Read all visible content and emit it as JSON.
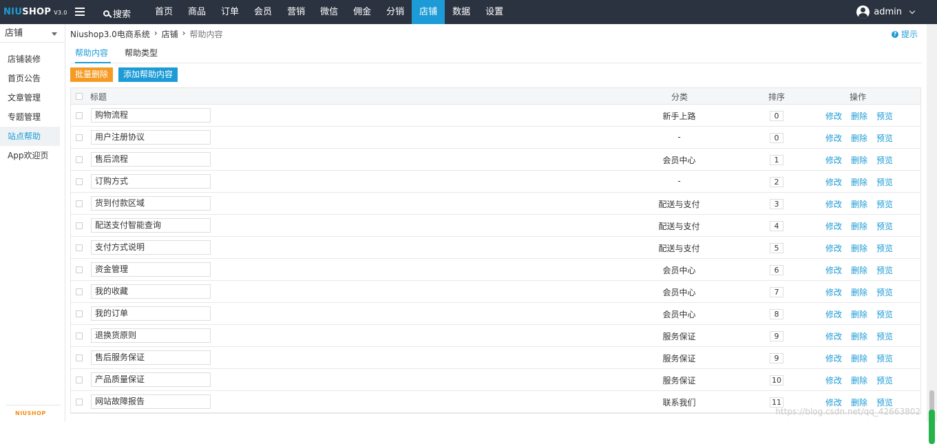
{
  "header": {
    "logo": {
      "niu": "NIU",
      "shop": "SHOP",
      "version": "V3.0"
    },
    "search_label": "搜索",
    "nav": [
      "首页",
      "商品",
      "订单",
      "会员",
      "营销",
      "微信",
      "佣金",
      "分销",
      "店铺",
      "数据",
      "设置"
    ],
    "nav_active": "店铺",
    "user": "admin"
  },
  "sidebar": {
    "section": "店铺",
    "items": [
      "店铺装修",
      "首页公告",
      "文章管理",
      "专题管理",
      "站点帮助",
      "App欢迎页"
    ],
    "active": "站点帮助",
    "footer_logo": "NIUSHOP"
  },
  "breadcrumb": [
    "Niushop3.0电商系统",
    "店铺",
    "帮助内容"
  ],
  "tip": "提示",
  "tabs": [
    "帮助内容",
    "帮助类型"
  ],
  "actions": {
    "batch_delete": "批量删除",
    "add": "添加帮助内容"
  },
  "table": {
    "headers": {
      "title": "标题",
      "category": "分类",
      "sort": "排序",
      "ops": "操作"
    },
    "ops": [
      "修改",
      "删除",
      "预览"
    ],
    "rows": [
      {
        "title": "购物流程",
        "category": "新手上路",
        "sort": "0"
      },
      {
        "title": "用户注册协议",
        "category": "-",
        "sort": "0"
      },
      {
        "title": "售后流程",
        "category": "会员中心",
        "sort": "1"
      },
      {
        "title": "订购方式",
        "category": "-",
        "sort": "2"
      },
      {
        "title": "货到付款区域",
        "category": "配送与支付",
        "sort": "3"
      },
      {
        "title": "配送支付智能查询",
        "category": "配送与支付",
        "sort": "4"
      },
      {
        "title": "支付方式说明",
        "category": "配送与支付",
        "sort": "5"
      },
      {
        "title": "资金管理",
        "category": "会员中心",
        "sort": "6"
      },
      {
        "title": "我的收藏",
        "category": "会员中心",
        "sort": "7"
      },
      {
        "title": "我的订单",
        "category": "会员中心",
        "sort": "8"
      },
      {
        "title": "退换货原则",
        "category": "服务保证",
        "sort": "9"
      },
      {
        "title": "售后服务保证",
        "category": "服务保证",
        "sort": "9"
      },
      {
        "title": "产品质量保证",
        "category": "服务保证",
        "sort": "10"
      },
      {
        "title": "网站故障报告",
        "category": "联系我们",
        "sort": "11"
      }
    ]
  },
  "watermark": "https://blog.csdn.net/qq_42663802",
  "colors": {
    "topbar": "#2c3340",
    "accent": "#1c9bd6",
    "orange": "#f59a23"
  }
}
